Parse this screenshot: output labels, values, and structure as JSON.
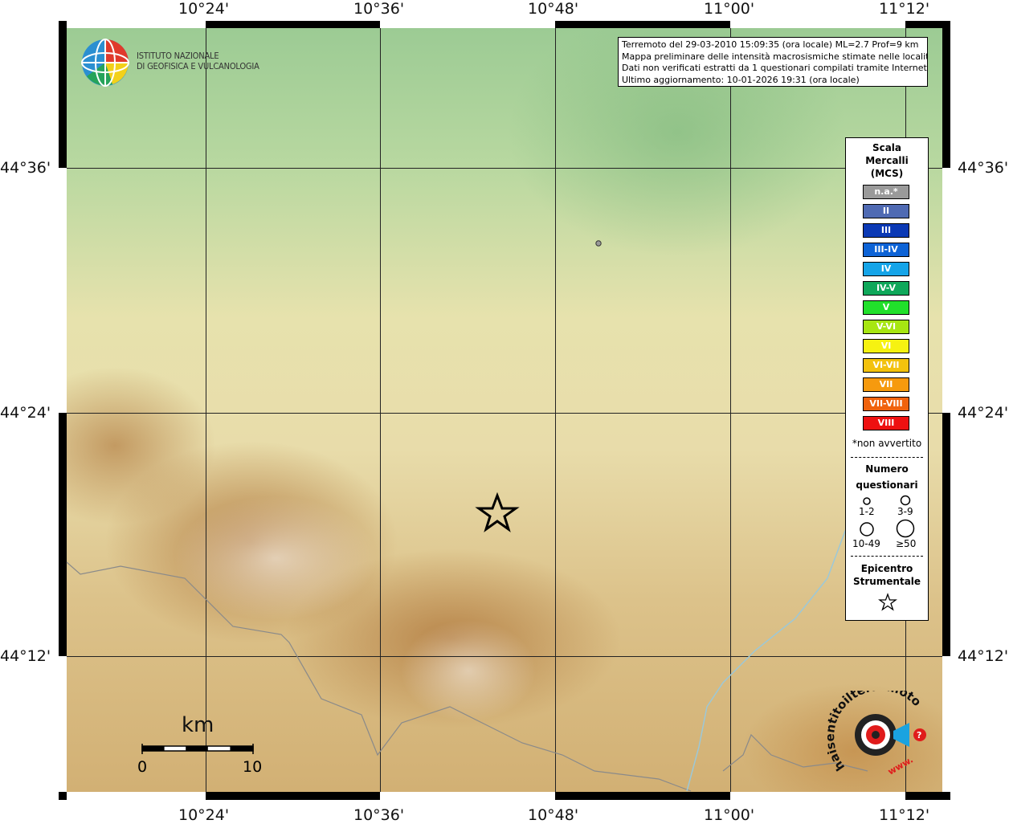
{
  "map": {
    "lon_labels": [
      "10°24'",
      "10°36'",
      "10°48'",
      "11°00'",
      "11°12'"
    ],
    "lat_labels": [
      "44°36'",
      "44°24'",
      "44°12'"
    ]
  },
  "institute": {
    "line1": "ISTITUTO NAZIONALE",
    "line2": "DI GEOFISICA E VULCANOLOGIA"
  },
  "info": {
    "line1": "Terremoto del 29-03-2010 15:09:35 (ora locale) ML=2.7 Prof=9 km",
    "line2": "Mappa preliminare delle intensità macrosismiche stimate nelle località",
    "line3": "Dati non verificati estratti da 1 questionari compilati tramite Internet.",
    "line4": "Ultimo aggiornamento: 10-01-2026 19:31 (ora locale)"
  },
  "legend": {
    "title1": "Scala",
    "title2": "Mercalli",
    "title3": "(MCS)",
    "intensities": [
      {
        "label": "n.a.*",
        "color": "#9a9a9a"
      },
      {
        "label": "II",
        "color": "#4f6ab3"
      },
      {
        "label": "III",
        "color": "#0b39b5"
      },
      {
        "label": "III-IV",
        "color": "#0d63d6"
      },
      {
        "label": "IV",
        "color": "#15a4e8"
      },
      {
        "label": "IV-V",
        "color": "#0fa85a"
      },
      {
        "label": "V",
        "color": "#21e02b"
      },
      {
        "label": "V-VI",
        "color": "#a7e612"
      },
      {
        "label": "VI",
        "color": "#f6f211"
      },
      {
        "label": "VI-VII",
        "color": "#f3c20e"
      },
      {
        "label": "VII",
        "color": "#f69a0e"
      },
      {
        "label": "VII-VIII",
        "color": "#f0620d"
      },
      {
        "label": "VIII",
        "color": "#ee1111"
      }
    ],
    "note": "*non avvertito",
    "count_title1": "Numero",
    "count_title2": "questionari",
    "count_labels": [
      "1-2",
      "3-9",
      "10-49",
      "≥50"
    ],
    "epicenter_title1": "Epicentro",
    "epicenter_title2": "Strumentale"
  },
  "scale_bar": {
    "unit": "km",
    "start": "0",
    "end": "10"
  },
  "hsit_logo": {
    "text1": "haisentitoilterremoto.it",
    "text2": "www."
  }
}
